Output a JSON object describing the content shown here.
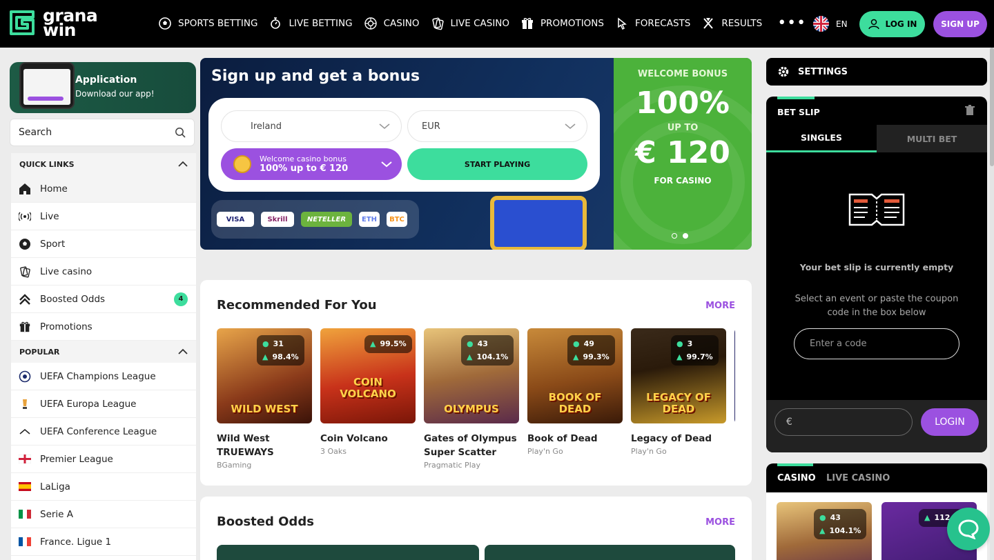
{
  "header": {
    "logo": "grana win",
    "logo_line1": "grana",
    "logo_line2": "win",
    "nav": [
      {
        "label": "SPORTS BETTING",
        "icon": "soccer-ball-icon"
      },
      {
        "label": "LIVE BETTING",
        "icon": "stopwatch-icon"
      },
      {
        "label": "CASINO",
        "icon": "roulette-icon"
      },
      {
        "label": "LIVE CASINO",
        "icon": "cards-icon"
      },
      {
        "label": "PROMOTIONS",
        "icon": "gift-icon"
      },
      {
        "label": "FORECASTS",
        "icon": "cursor-icon"
      },
      {
        "label": "RESULTS",
        "icon": "trophy-icon"
      }
    ],
    "more": "•••",
    "lang": "EN",
    "login": "LOG IN",
    "signup": "SIGN UP"
  },
  "sidebar": {
    "app_title": "Application",
    "app_subtitle": "Download our app!",
    "search_placeholder": "Search",
    "quick_links_title": "QUICK LINKS",
    "quick_links": [
      {
        "label": "Home",
        "icon": "home-icon"
      },
      {
        "label": "Live",
        "icon": "live-signal-icon"
      },
      {
        "label": "Sport",
        "icon": "soccer-ball-icon"
      },
      {
        "label": "Live casino",
        "icon": "cards-icon"
      },
      {
        "label": "Boosted Odds",
        "icon": "chevrons-up-icon",
        "badge": "4"
      },
      {
        "label": "Promotions",
        "icon": "gift-icon"
      }
    ],
    "popular_title": "POPULAR",
    "popular": [
      {
        "label": "UEFA Champions League",
        "icon": "champions-league-icon"
      },
      {
        "label": "UEFA Europa League",
        "icon": "europa-league-icon"
      },
      {
        "label": "UEFA Conference League",
        "icon": "conference-league-icon"
      },
      {
        "label": "Premier League",
        "icon": "england-flag-icon"
      },
      {
        "label": "LaLiga",
        "icon": "spain-flag-icon"
      },
      {
        "label": "Serie A",
        "icon": "italy-flag-icon"
      },
      {
        "label": "France. Ligue 1",
        "icon": "france-flag-icon"
      }
    ]
  },
  "hero": {
    "title": "Sign up and get a bonus",
    "country": "Ireland",
    "currency": "EUR",
    "bonus_label": "Welcome casino bonus",
    "bonus_value": "100% up to € 120",
    "start_button": "START PLAYING",
    "payments": [
      "VISA",
      "Skrill",
      "NETELLER",
      "ETH",
      "BTC"
    ],
    "promo": {
      "heading": "WELCOME BONUS",
      "percent": "100%",
      "up_to": "UP TO",
      "amount": "€ 120",
      "for": "FOR CASINO"
    }
  },
  "recommended": {
    "title": "Recommended For You",
    "more": "MORE",
    "games": [
      {
        "title": "Wild West TRUEWAYS",
        "provider": "BGaming",
        "players": "31",
        "rtp": "98.4%",
        "thumb_text": "WILD WEST",
        "bg": "#8a3a1a"
      },
      {
        "title": "Coin Volcano",
        "provider": "3 Oaks",
        "players": "",
        "rtp": "99.5%",
        "thumb_text": "COIN VOLCANO",
        "bg": "#c8321a"
      },
      {
        "title": "Gates of Olympus Super Scatter",
        "provider": "Pragmatic Play",
        "players": "43",
        "rtp": "104.1%",
        "thumb_text": "OLYMPUS",
        "bg": "#a06a3a"
      },
      {
        "title": "Book of Dead",
        "provider": "Play'n Go",
        "players": "49",
        "rtp": "99.3%",
        "thumb_text": "BOOK OF DEAD",
        "bg": "#8a4a18"
      },
      {
        "title": "Legacy of Dead",
        "provider": "Play'n Go",
        "players": "3",
        "rtp": "99.7%",
        "thumb_text": "LEGACY OF DEAD",
        "bg": "#2a1a0a"
      }
    ]
  },
  "boosted": {
    "title": "Boosted Odds",
    "more": "MORE"
  },
  "right": {
    "settings": "SETTINGS",
    "betslip_title": "BET SLIP",
    "tab_singles": "SINGLES",
    "tab_multi": "MULTI BET",
    "empty_title": "Your bet slip is currently empty",
    "empty_hint": "Select an event or paste the coupon code in the box below",
    "code_placeholder": "Enter a code",
    "amount_prefix": "€",
    "login": "LOGIN",
    "tab_casino": "CASINO",
    "tab_live_casino": "LIVE CASINO",
    "casino_card1_players": "43",
    "casino_card1_rtp": "104.1%",
    "casino_card2_players": "112.3"
  },
  "colors": {
    "accent_green": "#3ddd9d",
    "accent_purple": "#9b51e0",
    "promo_green": "#4cb23b"
  }
}
